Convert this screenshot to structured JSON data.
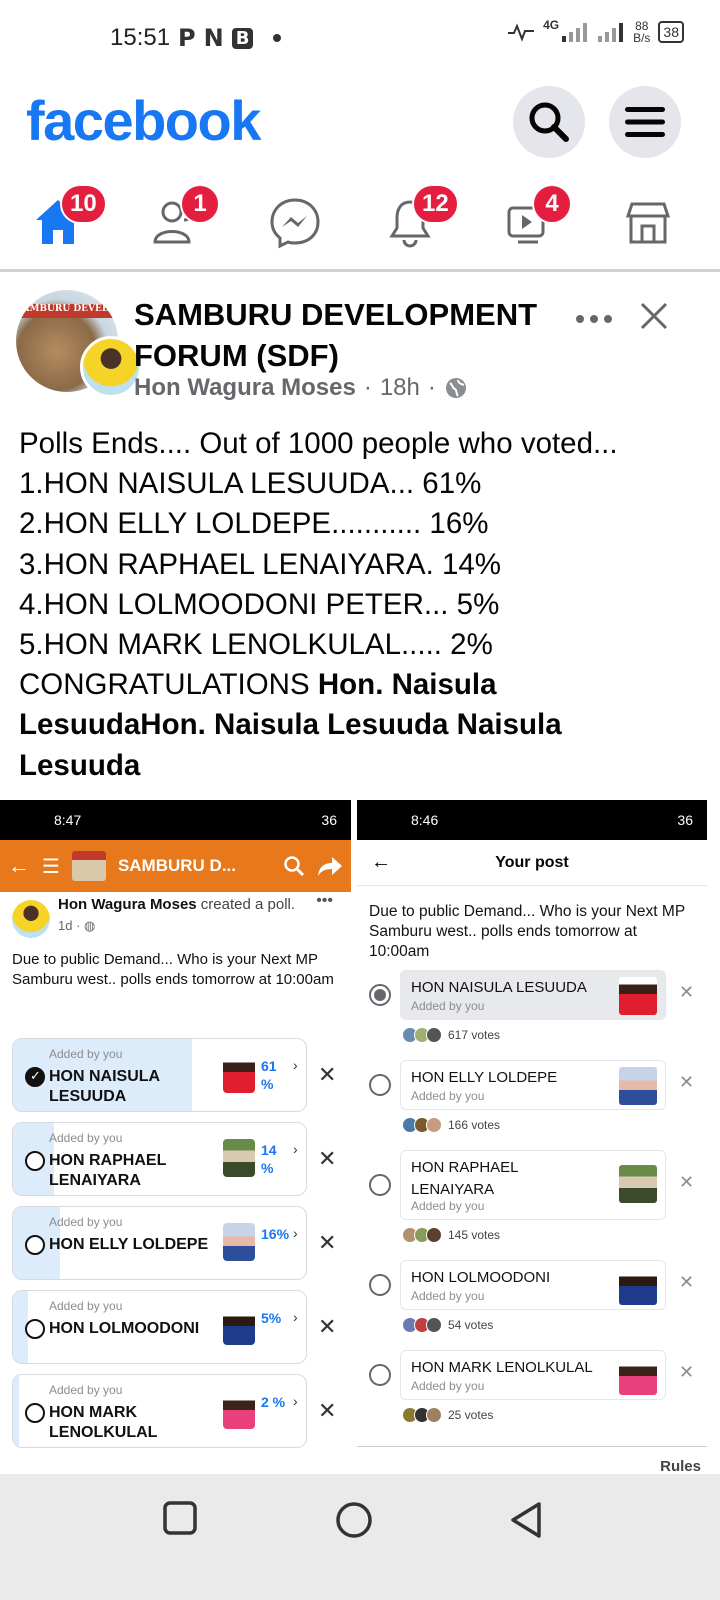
{
  "status": {
    "time": "15:51",
    "icons_left": [
      "P",
      "N",
      "B"
    ],
    "net_speed_top": "88",
    "net_speed_bottom": "B/s",
    "network": "4G",
    "battery": "38"
  },
  "header": {
    "logo": "facebook"
  },
  "nav": {
    "home_badge": "10",
    "friends_badge": "1",
    "notifications_badge": "12",
    "watch_badge": "4"
  },
  "post": {
    "page_name": "SAMBURU DEVELOPMENT FORUM (SDF)",
    "author": "Hon Wagura Moses",
    "time": "18h",
    "lines": [
      "Polls Ends.... Out of 1000 people who voted...",
      "1.HON NAISULA LESUUDA... 61%",
      "2.HON ELLY LOLDEPE........... 16%",
      "3.HON RAPHAEL LENAIYARA. 14%",
      "4.HON LOLMOODONI PETER... 5%",
      "5.HON MARK LENOLKULAL..... 2%"
    ],
    "congrats_plain": "CONGRATULATIONS ",
    "congrats_bold_1": "Hon. Naisula",
    "congrats_bold_2": "LesuudaHon. Naisula Lesuuda Naisula",
    "congrats_bold_3": "Lesuuda"
  },
  "left_shot": {
    "time": "8:47",
    "status_right": "36",
    "bar_title": "SAMBURU D...",
    "author": "Hon Wagura Moses",
    "action": " created a poll.",
    "when": "1d ·",
    "text": "Due to public Demand... Who is your Next MP Samburu west.. polls ends tomorrow at 10:00am",
    "added_by": "Added by you",
    "options": [
      {
        "name_1": "HON NAISULA",
        "name_2": "LESUUDA",
        "pct": "61 %",
        "fill": 0.61,
        "checked": true
      },
      {
        "name_1": "HON RAPHAEL",
        "name_2": "LENAIYARA",
        "pct": "14 %",
        "fill": 0.14,
        "checked": false
      },
      {
        "name_1": "HON ELLY LOLDEPE",
        "name_2": "",
        "pct": "16%",
        "fill": 0.16,
        "checked": false
      },
      {
        "name_1": "HON LOLMOODONI",
        "name_2": "",
        "pct": "5%",
        "fill": 0.05,
        "checked": false
      },
      {
        "name_1": "HON MARK",
        "name_2": "LENOLKULAL",
        "pct": "2 %",
        "fill": 0.02,
        "checked": false
      }
    ]
  },
  "right_shot": {
    "time": "8:46",
    "status_right": "36",
    "title": "Your post",
    "text": "Due to public Demand... Who is your Next MP Samburu west.. polls ends tomorrow at 10:00am",
    "added_by": "Added by you",
    "options": [
      {
        "name": "HON NAISULA LESUUDA",
        "votes": "617 votes",
        "selected": true
      },
      {
        "name": "HON ELLY LOLDEPE",
        "votes": "166 votes",
        "selected": false
      },
      {
        "name": "HON RAPHAEL LENAIYARA",
        "votes": "145 votes",
        "selected": false
      },
      {
        "name": "HON LOLMOODONI",
        "votes": "54 votes",
        "selected": false
      },
      {
        "name": "HON MARK LENOLKULAL",
        "votes": "25 votes",
        "selected": false
      }
    ],
    "rules": "Rules"
  },
  "colors": {
    "brand": "#1877f2",
    "badge": "#e41e3f",
    "app_bar": "#e8781c"
  }
}
